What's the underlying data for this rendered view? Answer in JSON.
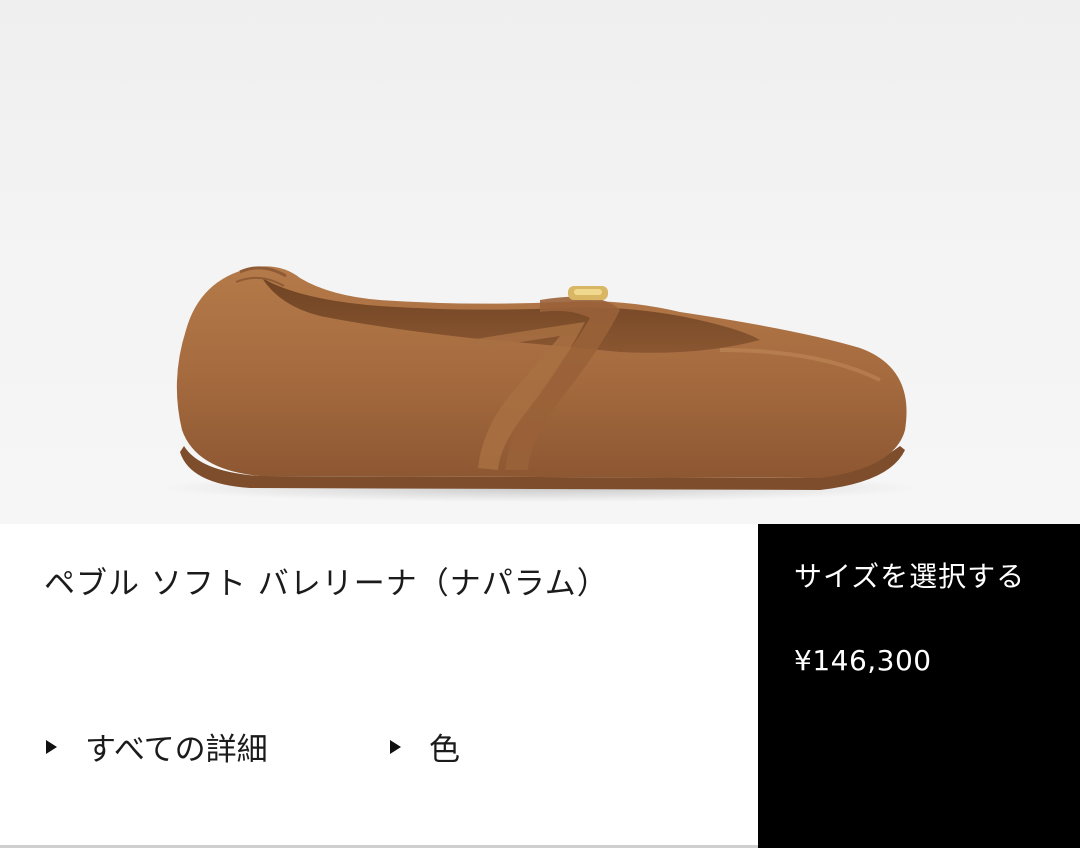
{
  "product": {
    "name": "ペブル ソフト バレリーナ（ナパラム）",
    "image_alt": "shoe-product-image"
  },
  "links": {
    "details_label": "すべての詳細",
    "color_label": "色"
  },
  "cta": {
    "label": "サイズを選択する",
    "price": "¥146,300"
  },
  "colors": {
    "leather": "#a46a3e",
    "cta_background": "#000000",
    "hero_background": "#f2f2f2"
  }
}
